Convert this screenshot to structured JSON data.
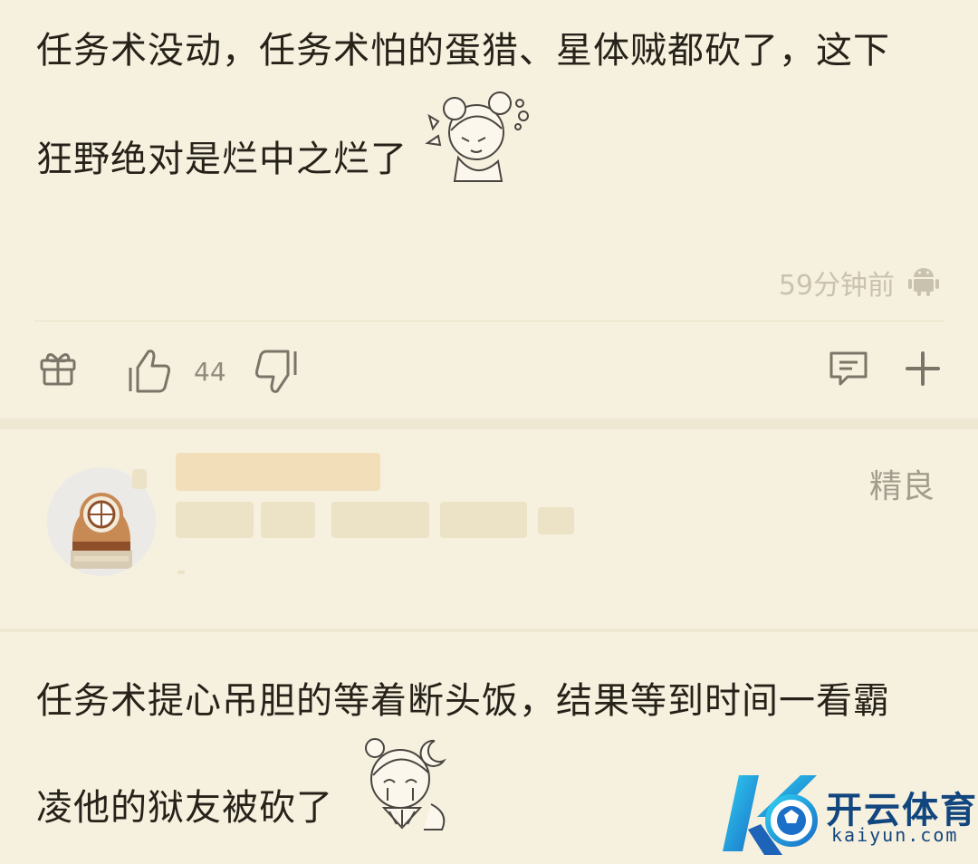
{
  "comment1": {
    "line1": "任务术没动，任务术怕的蛋猎、星体贼都砍了，这下",
    "line2": "狂野绝对是烂中之烂了",
    "time": "59分钟前",
    "device_icon": "android-icon",
    "like_count": "44",
    "actions": [
      "gift-icon",
      "thumbs-up-icon",
      "thumbs-down-icon",
      "comment-icon",
      "plus-icon"
    ]
  },
  "profile_card": {
    "badge": "精良",
    "avatar_icon": "diving-helmet-avatar"
  },
  "comment2": {
    "line1": "任务术提心吊胆的等着断头饭，结果等到时间一看霸",
    "line2": "凌他的狱友被砍了"
  },
  "watermark": {
    "name": "开云体育",
    "url": "kaiyun.com"
  },
  "colors": {
    "background": "#f6f0de",
    "text": "#262219",
    "muted": "#c9c2ae",
    "brand": "#12467e",
    "brand_cyan": "#19a8dc"
  }
}
